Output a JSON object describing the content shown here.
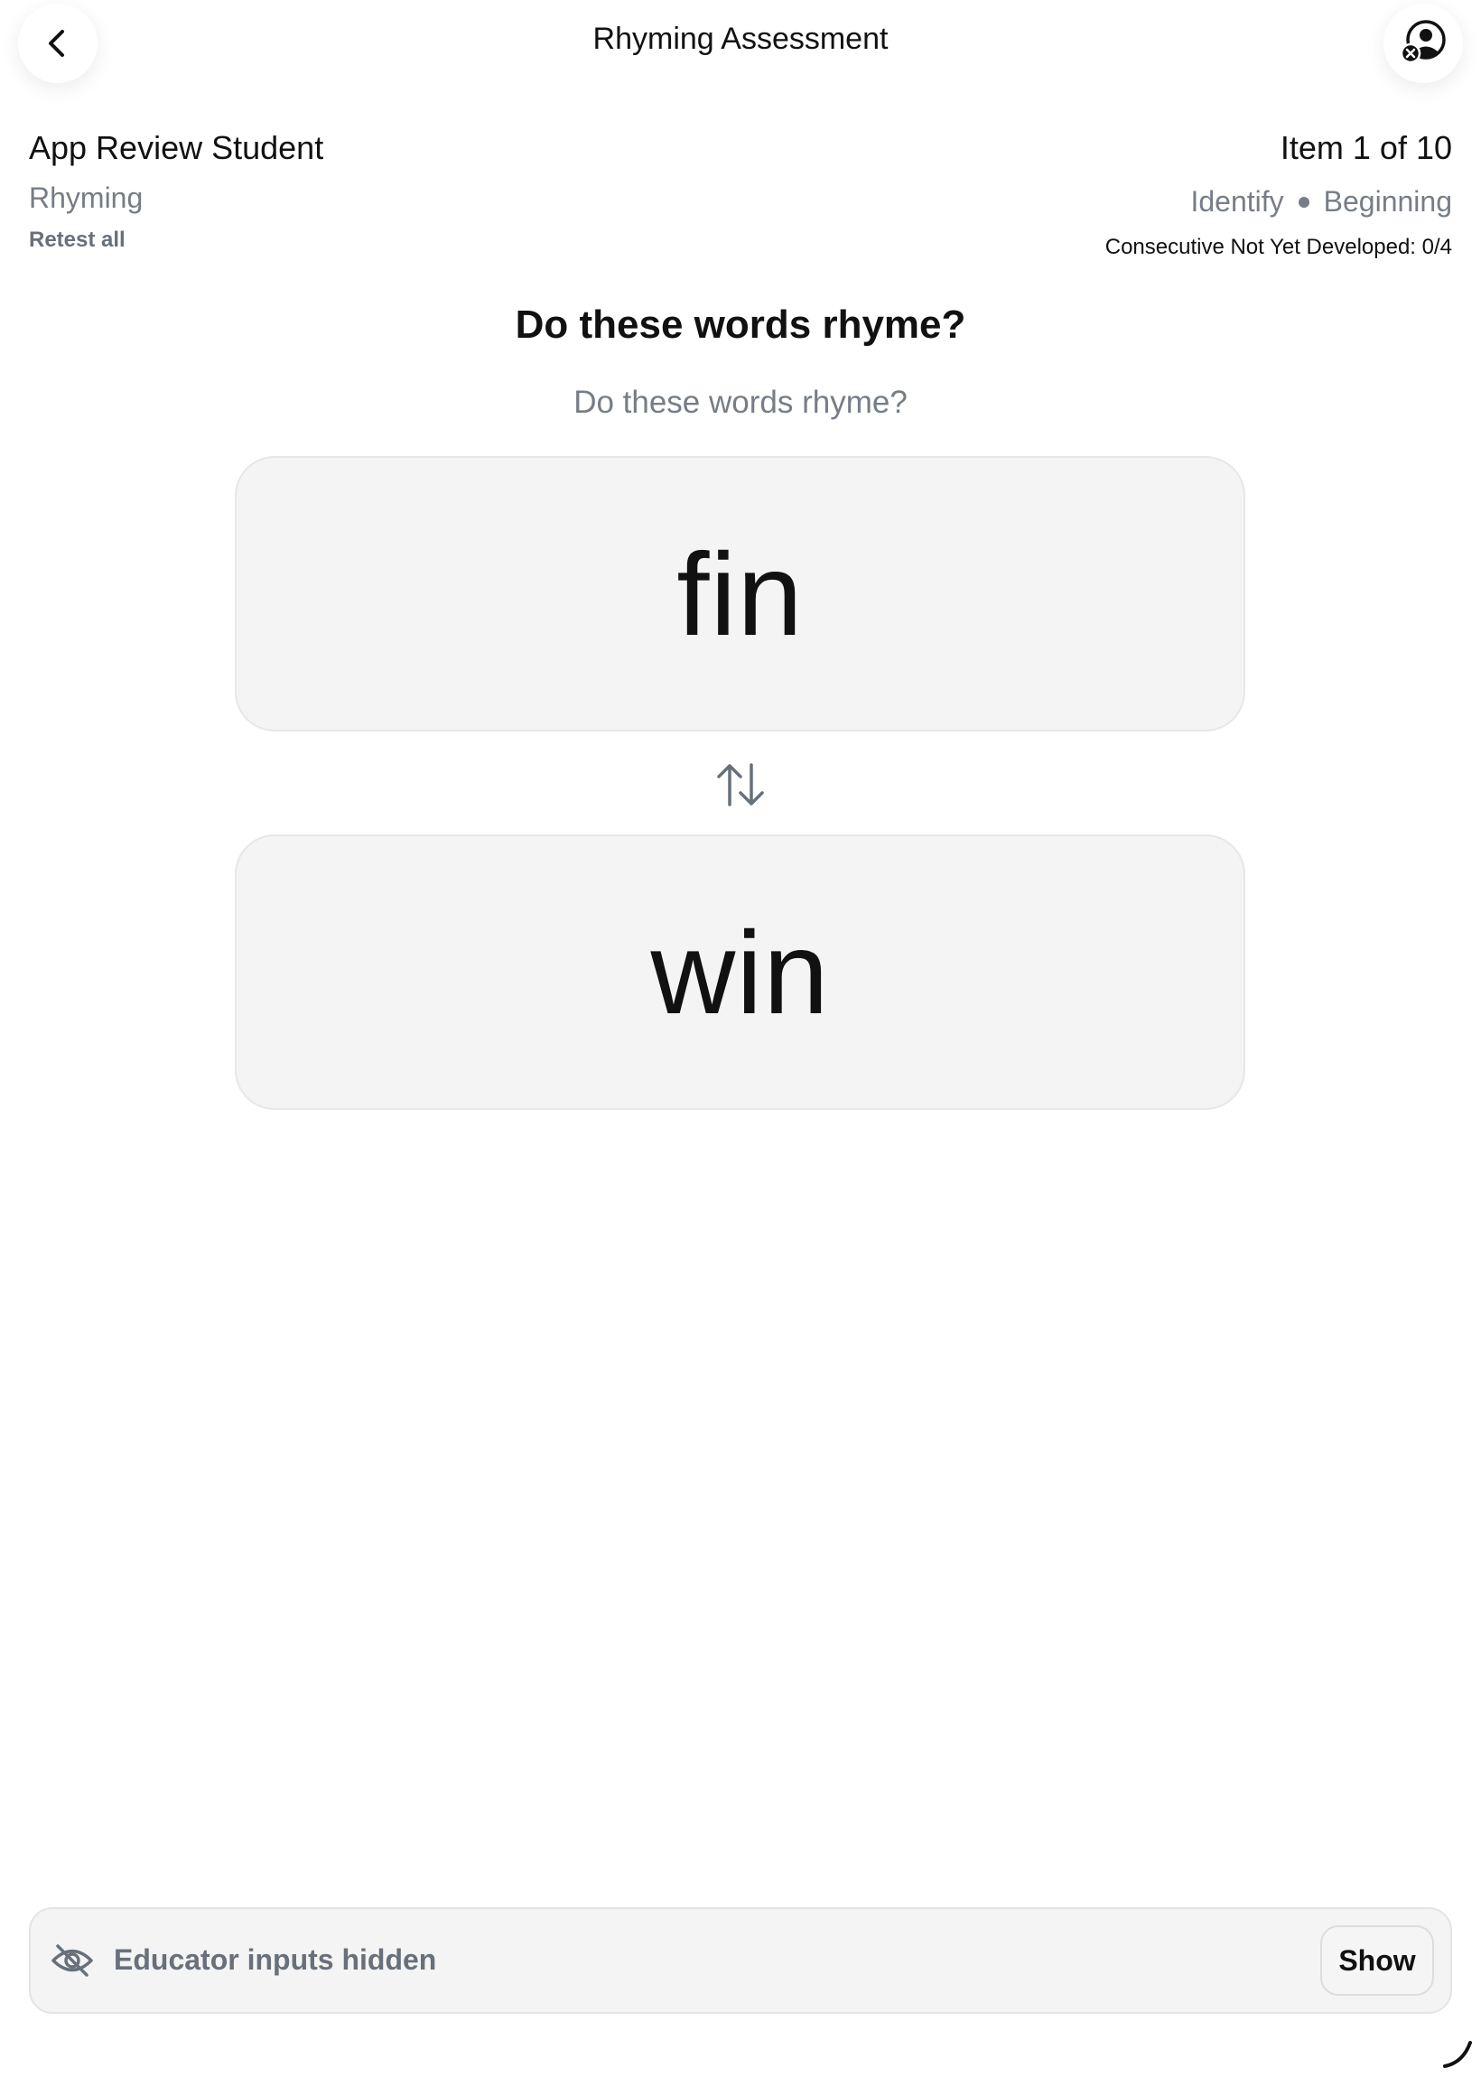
{
  "header": {
    "title": "Rhyming Assessment",
    "back_icon": "chevron-left-icon",
    "profile_icon": "user-remove-icon"
  },
  "student": {
    "name": "App Review Student",
    "skill": "Rhyming",
    "retest_label": "Retest all"
  },
  "progress": {
    "item_label": "Item 1 of 10",
    "task_type": "Identify",
    "level": "Beginning",
    "consecutive_label": "Consecutive Not Yet Developed: 0/4"
  },
  "prompt": {
    "heading": "Do these words rhyme?",
    "subheading": "Do these words rhyme?"
  },
  "words": [
    {
      "text": "fin"
    },
    {
      "text": "win"
    }
  ],
  "swap_icon": "swap-vertical-icon",
  "educator_panel": {
    "icon": "eye-off-icon",
    "label": "Educator inputs hidden",
    "show_label": "Show"
  },
  "colors": {
    "text_primary": "#111111",
    "text_secondary": "#767d87",
    "card_background": "#f4f4f4",
    "card_border": "#e6e7e9"
  }
}
